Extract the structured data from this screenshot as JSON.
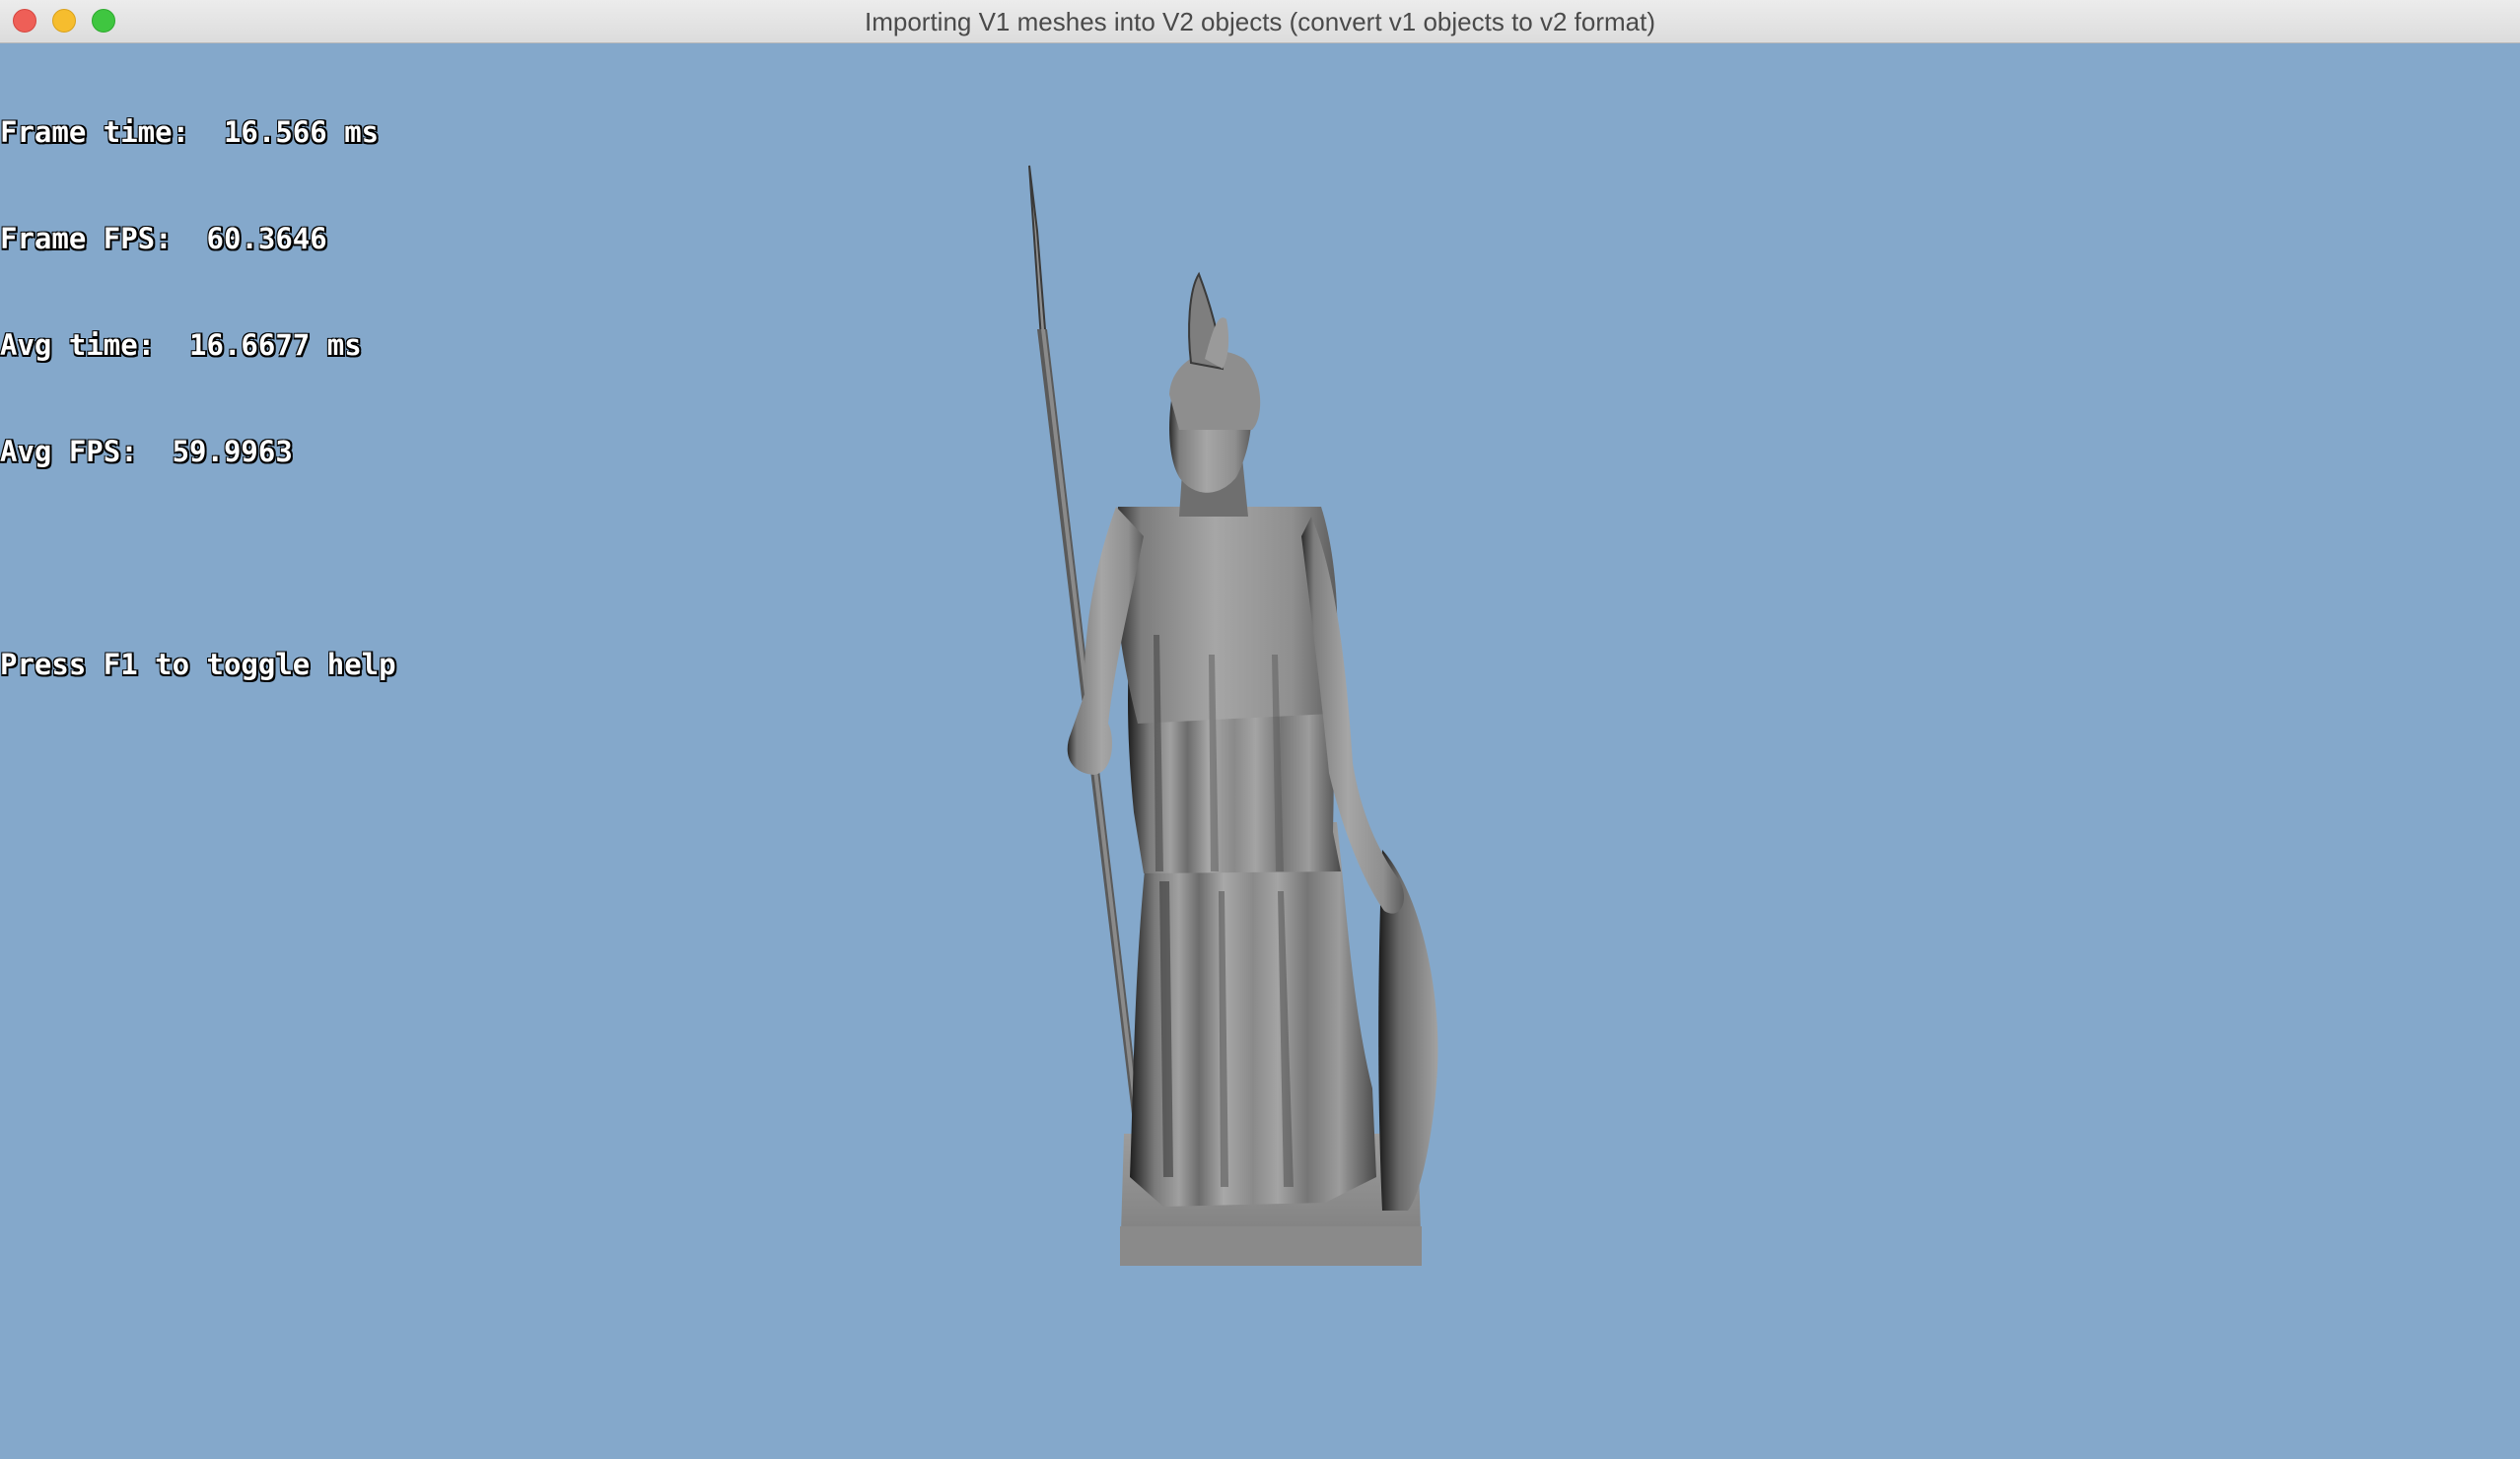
{
  "window": {
    "title": "Importing V1 meshes into V2 objects (convert v1 objects to v2 format)",
    "background": "#84a8cb"
  },
  "hud": {
    "frame_time": "Frame time:  16.566 ms",
    "frame_fps": "Frame FPS:  60.3646",
    "avg_time": "Avg time:  16.6677 ms",
    "avg_fps": "Avg FPS:  59.9963",
    "help_hint": "Press F1 to toggle help"
  },
  "scene": {
    "model_icon": "statue-3d-model",
    "model_color": "#9a9a9a"
  }
}
